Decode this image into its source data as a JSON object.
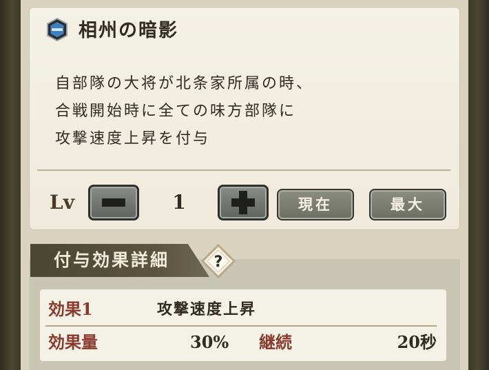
{
  "skill": {
    "title": "相州の暗影",
    "icon": "blue-gem-icon",
    "description": [
      "自部隊の大将が北条家所属の時、",
      "合戦開始時に全ての味方部隊に",
      "攻撃速度上昇を付与"
    ]
  },
  "level": {
    "label": "Lv",
    "value": "1",
    "current_label": "現在",
    "max_label": "最大"
  },
  "effect_section": {
    "title": "付与効果詳細",
    "help_icon": "question-icon",
    "effect_label": "効果1",
    "effect_name": "攻撃速度上昇",
    "amount_label": "効果量",
    "amount_value": "30%",
    "duration_label": "継続",
    "duration_value": "20秒"
  },
  "colors": {
    "panel": "#efeadc",
    "button": "#6b6d62",
    "label_red": "#8a3a2c",
    "gem_blue": "#3f7fc2"
  }
}
